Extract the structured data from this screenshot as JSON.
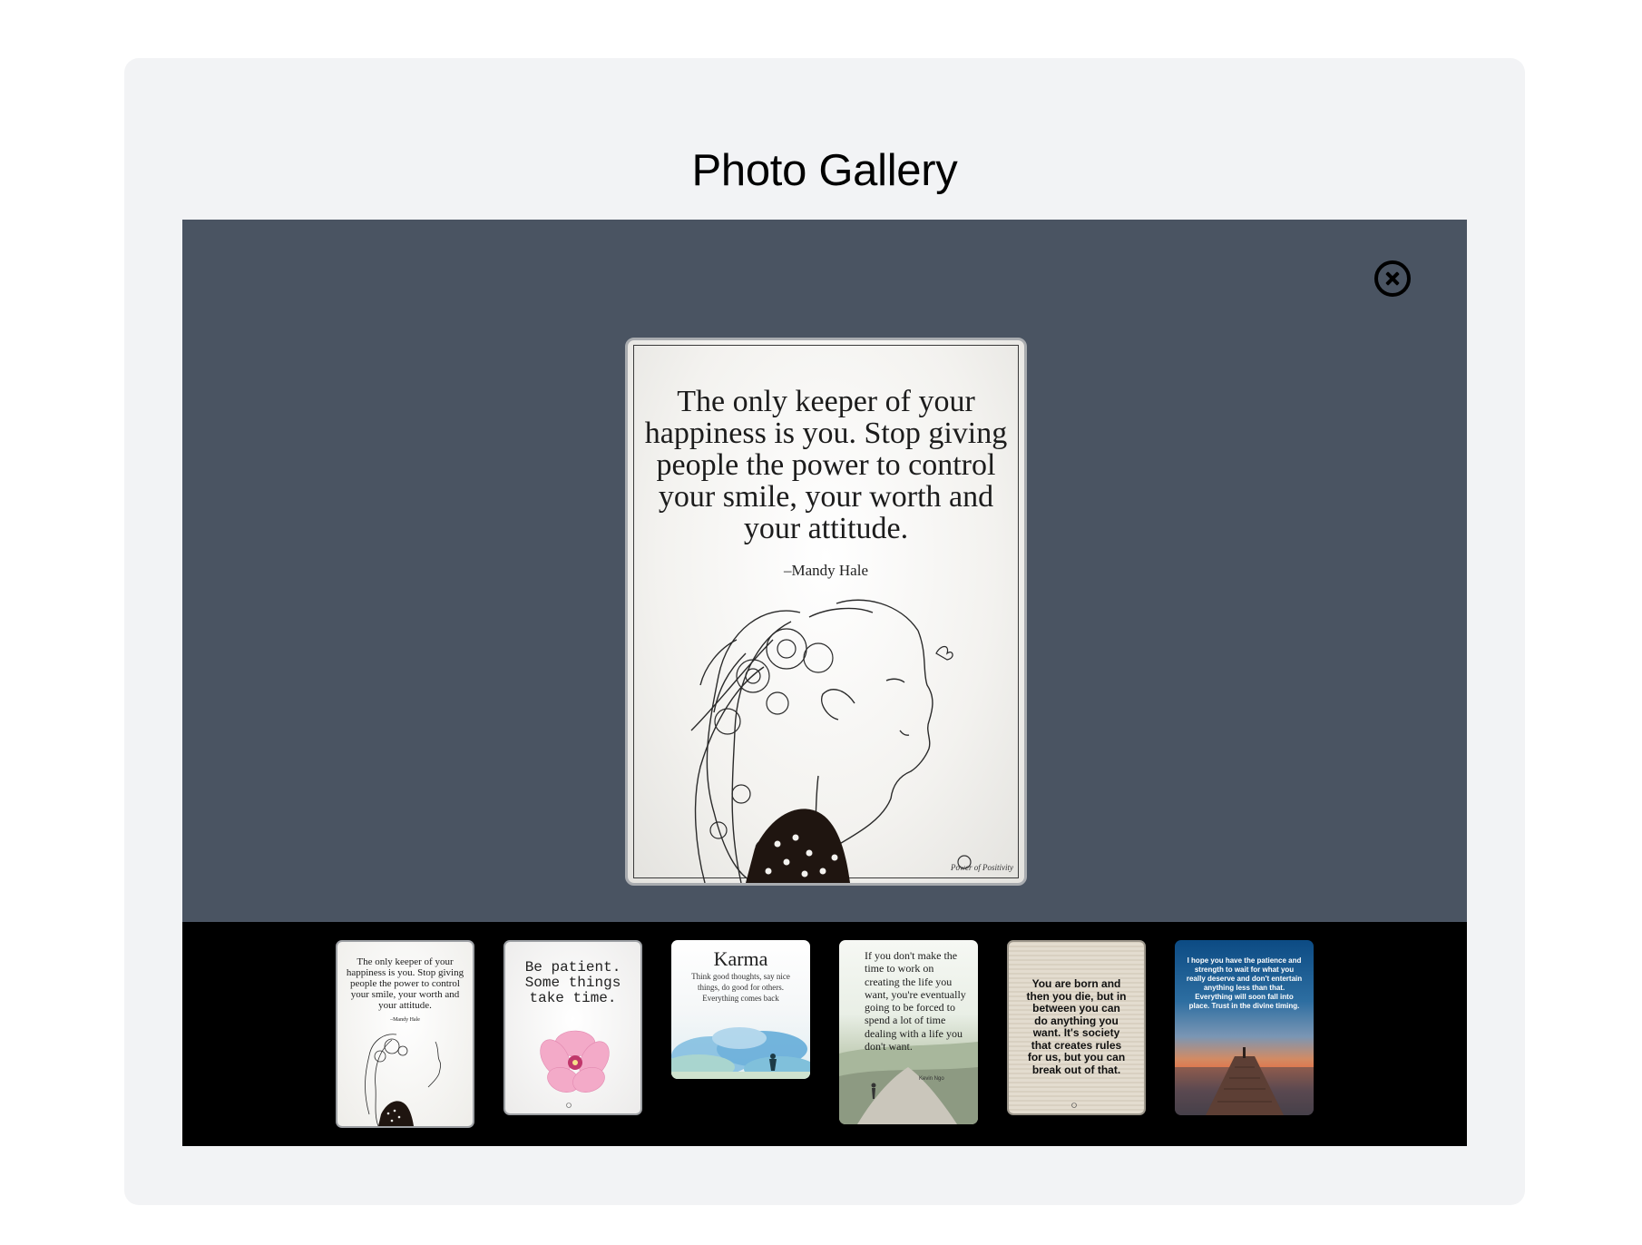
{
  "page": {
    "title": "Photo Gallery"
  },
  "viewer": {
    "close_icon": "close-circle-icon",
    "main_photo": {
      "quote": "The only keeper of your happiness is you. Stop giving people the power to control your smile, your worth and your attitude.",
      "author": "–Mandy Hale",
      "watermark": "Power of Positivity"
    }
  },
  "thumbnails": [
    {
      "title": "The only keeper of your happiness is you. Stop giving people the power to control your smile, your worth and your attitude.",
      "subtitle": "–Mandy Hale"
    },
    {
      "title": "Be patient. Some things take time."
    },
    {
      "title": "Karma",
      "subtitle": "Think good thoughts, say nice things, do good for others. Everything comes back"
    },
    {
      "title": "If you don't make the time to work on creating the life you want, you're eventually going to be forced to spend a lot of time dealing with a life you don't want.",
      "subtitle": "Kevin Ngo"
    },
    {
      "title": "You are born and then you die, but in between you can do anything you want. It's society that creates rules for us, but you can break out of that."
    },
    {
      "title": "I hope you have the patience and strength to wait for what you really deserve and don't entertain anything less than that. Everything will soon fall into place. Trust in the divine timing."
    }
  ]
}
